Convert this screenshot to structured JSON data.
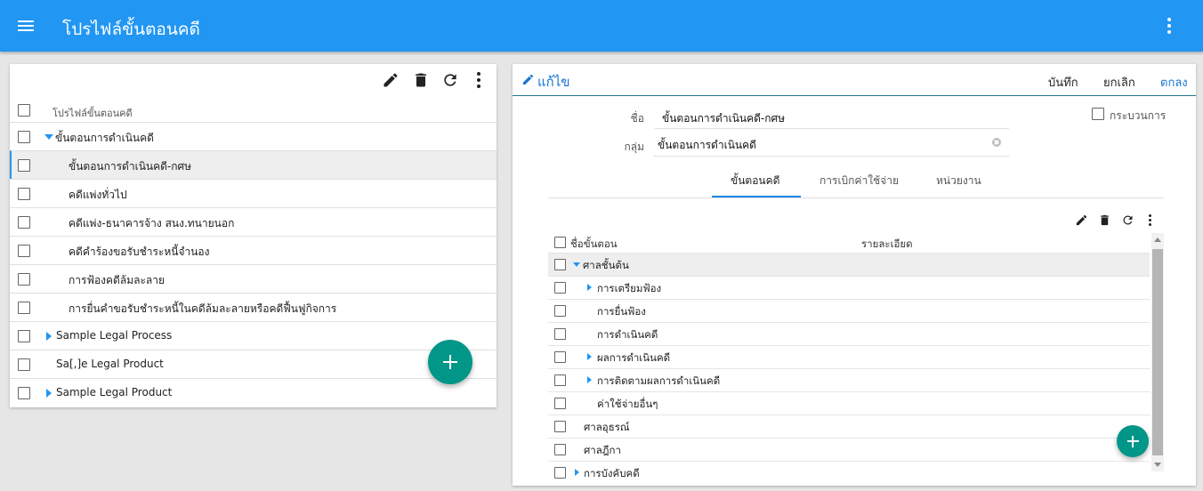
{
  "appbar": {
    "title": "โปรไฟล์ขั้นตอนคดี"
  },
  "left": {
    "column_header": "โปรไฟล์ขั้นตอนคดี",
    "rows": [
      {
        "label": "ขั้นตอนการดำเนินคดี"
      },
      {
        "label": "ขั้นตอนการดำเนินคดี-กศษ"
      },
      {
        "label": "คดีแพ่งทั่วไป"
      },
      {
        "label": "คดีแพ่ง-ธนาคารจ้าง สนง.ทนายนอก"
      },
      {
        "label": "คดีคำร้องขอรับชำระหนี้จำนอง"
      },
      {
        "label": "การฟ้องคดีล้มละลาย"
      },
      {
        "label": "การยื่นคำขอรับชำระหนี้ในคดีล้มละลายหรือคดีฟื้นฟูกิจการ"
      },
      {
        "label": "Sample Legal Process"
      },
      {
        "label": "Sa[,]e Legal Product"
      },
      {
        "label": "Sample Legal Product"
      }
    ]
  },
  "right": {
    "edit_title": "แก้ไข",
    "save_label": "บันทึก",
    "cancel_label": "ยกเลิก",
    "ok_label": "ตกลง",
    "name_label": "ชื่อ",
    "name_value": "ขั้นตอนการดำเนินคดี-กศษ",
    "group_label": "กลุ่ม",
    "group_value": "ขั้นตอนการดำเนินคดี",
    "process_label": "กระบวนการ",
    "tabs": [
      {
        "label": "ขั้นตอนคดี"
      },
      {
        "label": "การเบิกค่าใช้จ่าย"
      },
      {
        "label": "หน่วยงาน"
      }
    ],
    "grid": {
      "col_name": "ชื่อขั้นตอน",
      "col_detail": "รายละเอียด",
      "rows": [
        {
          "label": "ศาลชั้นต้น"
        },
        {
          "label": "การเตรียมฟ้อง"
        },
        {
          "label": "การยื่นฟ้อง"
        },
        {
          "label": "การดำเนินคดี"
        },
        {
          "label": "ผลการดำเนินคดี"
        },
        {
          "label": "การติดตามผลการดำเนินคดี"
        },
        {
          "label": "ค่าใช้จ่ายอื่นๆ"
        },
        {
          "label": "ศาลอุธรณ์"
        },
        {
          "label": "ศาลฎีกา"
        },
        {
          "label": "การบังคับคดี"
        }
      ]
    }
  },
  "colors": {
    "primary": "#2196f3",
    "fab": "#009688",
    "accent_line": "#1e7a8a"
  },
  "icons": [
    "menu-icon",
    "more-vert-icon",
    "pencil-icon",
    "trash-icon",
    "refresh-icon",
    "plus-icon",
    "clear-icon"
  ]
}
